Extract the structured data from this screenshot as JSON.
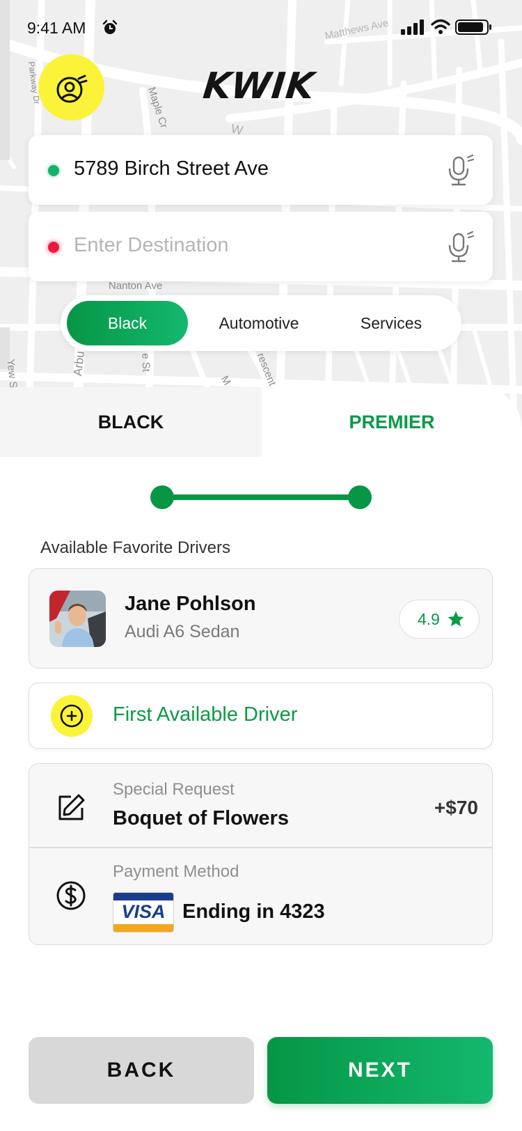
{
  "status_bar": {
    "time": "9:41 AM"
  },
  "app": {
    "brand": "KWIK"
  },
  "map": {
    "streets": [
      "Matthews Ave",
      "Parkway Dr",
      "Maple Cr",
      "Nanton Ave",
      "Arbu",
      "Yew S",
      "rescent",
      "e St",
      "W",
      "M"
    ]
  },
  "pickup": {
    "value": "5789 Birch Street Ave"
  },
  "destination": {
    "placeholder": "Enter Destination"
  },
  "categories": {
    "items": [
      "Black",
      "Automotive",
      "Services"
    ],
    "selected": "Black"
  },
  "tabs": {
    "items": [
      "BLACK",
      "PREMIER"
    ],
    "active": "PREMIER"
  },
  "favorites": {
    "label": "Available Favorite Drivers",
    "driver": {
      "name": "Jane Pohlson",
      "car": "Audi A6 Sedan",
      "rating": "4.9"
    }
  },
  "first_available": {
    "label": "First Available Driver"
  },
  "special_request": {
    "label": "Special Request",
    "value": "Boquet of Flowers",
    "price": "+$70"
  },
  "payment": {
    "label": "Payment Method",
    "brand": "VISA",
    "value": "Ending in 4323"
  },
  "buttons": {
    "back": "BACK",
    "next": "NEXT"
  },
  "colors": {
    "accent": "#069645",
    "yellow": "#fbf33a",
    "destination_dot": "#f0183c",
    "pickup_dot": "#0fb46b"
  }
}
